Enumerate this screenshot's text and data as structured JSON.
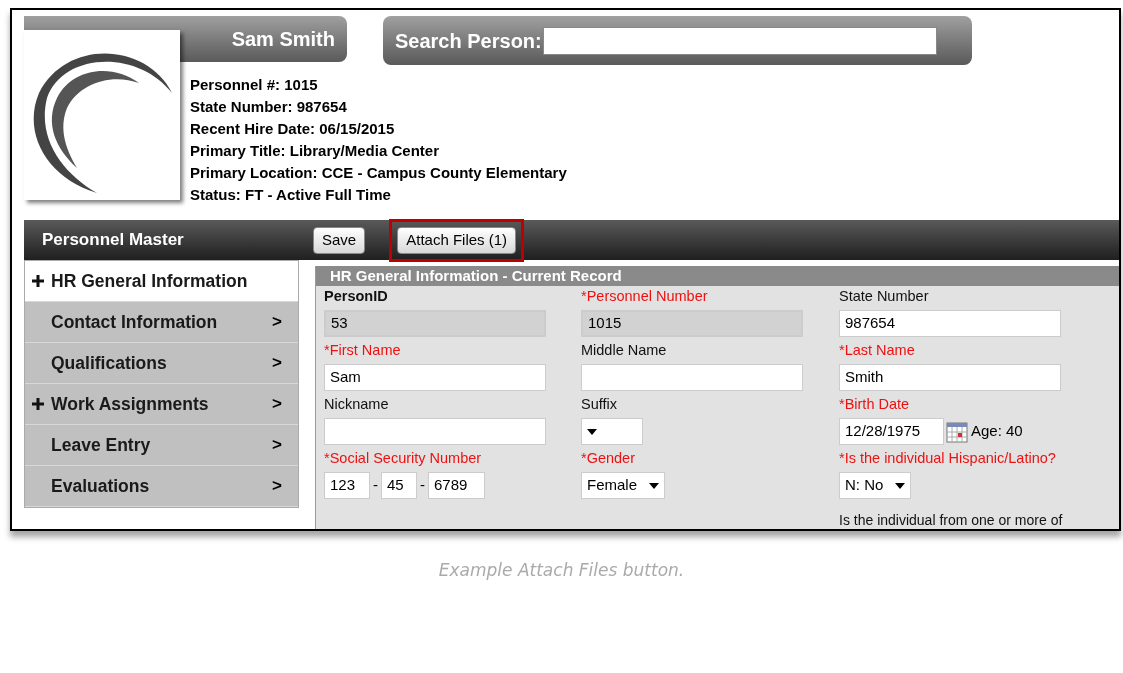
{
  "person": {
    "name": "Sam Smith",
    "info": [
      "Personnel #: 1015",
      "State Number: 987654",
      "Recent Hire Date: 06/15/2015",
      "Primary Title: Library/Media Center",
      "Primary Location: CCE - Campus County Elementary",
      "Status: FT - Active Full Time"
    ]
  },
  "search": {
    "label": "Search Person:"
  },
  "toolbar": {
    "title": "Personnel Master",
    "buttons": [
      {
        "label": "Save",
        "highlighted": false
      },
      {
        "label": "Attach Files (1)",
        "highlighted": true
      }
    ]
  },
  "sidebar": {
    "items": [
      {
        "label": "HR General Information",
        "expandable": true,
        "selected": true
      },
      {
        "label": "Contact Information",
        "expandable": false,
        "selected": false,
        "chevron": ">"
      },
      {
        "label": "Qualifications",
        "expandable": false,
        "selected": false,
        "chevron": ">"
      },
      {
        "label": "Work Assignments",
        "expandable": true,
        "selected": false,
        "chevron": ">"
      },
      {
        "label": "Leave Entry",
        "expandable": false,
        "selected": false,
        "chevron": ">"
      },
      {
        "label": "Evaluations",
        "expandable": false,
        "selected": false,
        "chevron": ">"
      }
    ]
  },
  "form": {
    "title": "HR General Information - Current Record",
    "fields": [
      {
        "kind": "text",
        "label": "PersonID",
        "bold": true,
        "required": false,
        "readonly": true,
        "value": "53"
      },
      {
        "kind": "text",
        "label": "*Personnel Number",
        "bold": false,
        "required": true,
        "readonly": true,
        "value": "1015"
      },
      {
        "kind": "text",
        "label": "State Number",
        "bold": false,
        "required": false,
        "readonly": false,
        "value": "987654"
      },
      {
        "kind": "text",
        "label": "*First Name",
        "bold": false,
        "required": true,
        "readonly": false,
        "value": "Sam"
      },
      {
        "kind": "text",
        "label": "Middle Name",
        "bold": false,
        "required": false,
        "readonly": false
      },
      {
        "kind": "text",
        "label": "*Last Name",
        "bold": false,
        "required": true,
        "readonly": false,
        "value": "Smith"
      },
      {
        "kind": "text",
        "label": "Nickname",
        "bold": false,
        "required": false,
        "readonly": false
      },
      {
        "kind": "select",
        "label": "Suffix",
        "bold": false,
        "required": false,
        "readonly": false
      },
      {
        "kind": "date",
        "label": "*Birth Date",
        "bold": false,
        "required": true,
        "readonly": false,
        "value": "12/28/1975",
        "age": "Age: 40"
      },
      {
        "kind": "ssn",
        "label": "*Social Security Number",
        "bold": false,
        "required": true,
        "readonly": false,
        "parts": [
          "123",
          "45",
          "6789"
        ],
        "separators": [
          "-",
          "-"
        ]
      },
      {
        "kind": "select",
        "label": "*Gender",
        "bold": false,
        "required": true,
        "readonly": false,
        "value": "Female"
      },
      {
        "kind": "select",
        "label": "*Is the individual Hispanic/Latino?",
        "bold": false,
        "required": true,
        "readonly": false,
        "value": "N: No"
      },
      {
        "kind": "blank"
      },
      {
        "kind": "blank"
      },
      {
        "kind": "note",
        "label": "Is the individual from one or more of"
      }
    ]
  },
  "caption": "Example Attach Files button."
}
